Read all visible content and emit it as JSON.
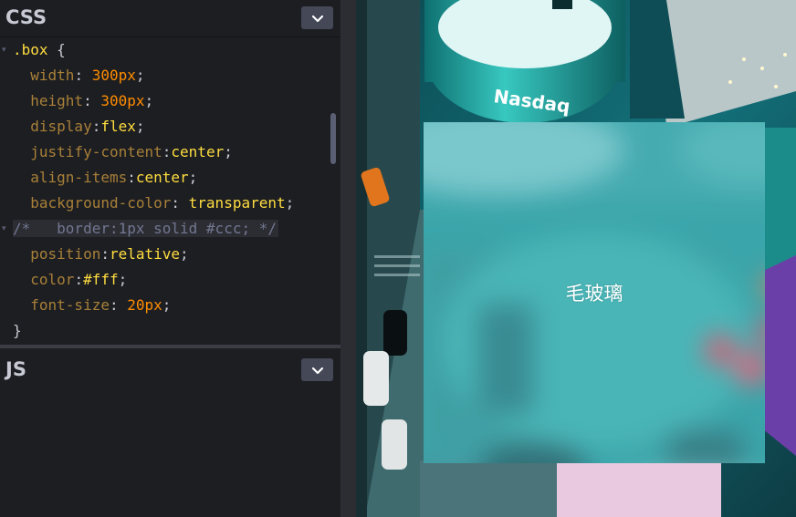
{
  "panels": {
    "css": {
      "title": "CSS"
    },
    "js": {
      "title": "JS"
    }
  },
  "code": {
    "selector": ".box",
    "open_brace": " {",
    "close_brace": "}",
    "comment": "/*   border:1px solid #ccc; */",
    "declarations": [
      {
        "prop": "width",
        "sep": ": ",
        "value": "300px",
        "value_type": "num"
      },
      {
        "prop": "height",
        "sep": ": ",
        "value": "300px",
        "value_type": "num"
      },
      {
        "prop": "display",
        "sep": ":",
        "value": "flex",
        "value_type": "kw"
      },
      {
        "prop": "justify-content",
        "sep": ":",
        "value": "center",
        "value_type": "kw"
      },
      {
        "prop": "align-items",
        "sep": ":",
        "value": "center",
        "value_type": "kw"
      },
      {
        "prop": "background-color",
        "sep": ": ",
        "value": "transparent",
        "value_type": "kw"
      },
      {
        "prop": "position",
        "sep": ":",
        "value": "relative",
        "value_type": "kw"
      },
      {
        "prop": "color",
        "sep": ":",
        "value": "#fff",
        "value_type": "kw"
      },
      {
        "prop": "font-size",
        "sep": ": ",
        "value": "20px",
        "value_type": "num"
      }
    ]
  },
  "preview": {
    "box_text": "毛玻璃",
    "sign_text": "Nasdaq"
  },
  "icons": {
    "panel_toggle": "chevron-down-icon",
    "fold": "fold-arrow-icon"
  },
  "colors": {
    "editor_bg": "#1d1e22",
    "selector": "#ffdd40",
    "property": "#a88038",
    "number": "#ff8c00",
    "comment": "#717790"
  }
}
